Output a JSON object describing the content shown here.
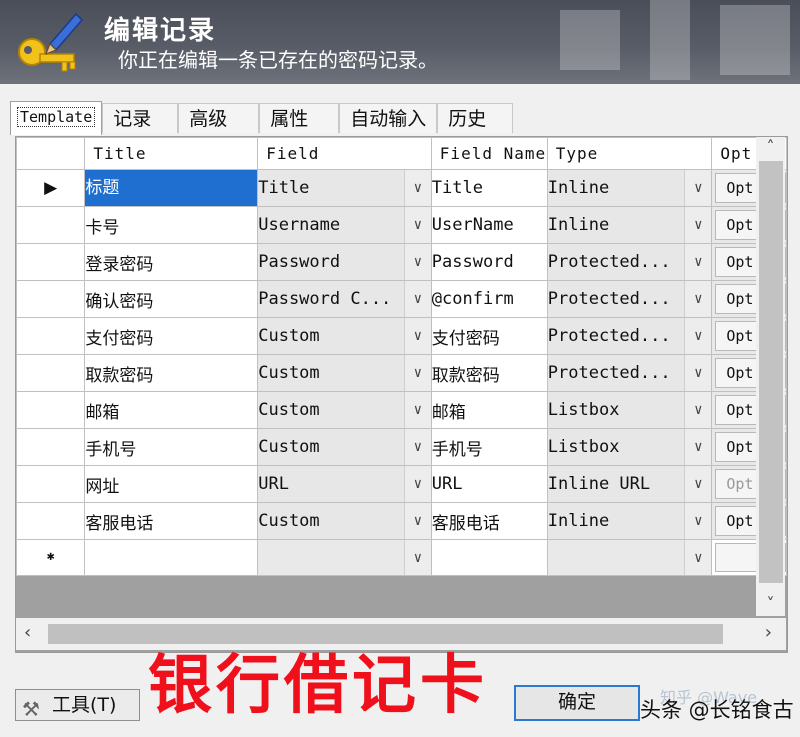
{
  "header": {
    "title": "编辑记录",
    "subtitle": "你正在编辑一条已存在的密码记录。"
  },
  "tabs": [
    {
      "label": "Template",
      "active": true
    },
    {
      "label": "记录"
    },
    {
      "label": "高级"
    },
    {
      "label": "属性"
    },
    {
      "label": "自动输入"
    },
    {
      "label": "历史"
    }
  ],
  "grid": {
    "columns": [
      "Title",
      "Field",
      "Field Name",
      "Type",
      "Opt"
    ],
    "rows": [
      {
        "title": "标题",
        "field": "Title",
        "field_name": "Title",
        "type": "Inline",
        "opt": "Opt"
      },
      {
        "title": "卡号",
        "field": "Username",
        "field_name": "UserName",
        "type": "Inline",
        "opt": "Opt"
      },
      {
        "title": "登录密码",
        "field": "Password",
        "field_name": "Password",
        "type": "Protected...",
        "opt": "Opt"
      },
      {
        "title": "确认密码",
        "field": "Password C...",
        "field_name": "@confirm",
        "type": "Protected...",
        "opt": "Opt"
      },
      {
        "title": "支付密码",
        "field": "Custom",
        "field_name": "支付密码",
        "type": "Protected...",
        "opt": "Opt"
      },
      {
        "title": "取款密码",
        "field": "Custom",
        "field_name": "取款密码",
        "type": "Protected...",
        "opt": "Opt"
      },
      {
        "title": "邮箱",
        "field": "Custom",
        "field_name": "邮箱",
        "type": "Listbox",
        "opt": "Opt"
      },
      {
        "title": "手机号",
        "field": "Custom",
        "field_name": "手机号",
        "type": "Listbox",
        "opt": "Opt"
      },
      {
        "title": "网址",
        "field": "URL",
        "field_name": "URL",
        "type": "Inline URL",
        "opt": "Opt"
      },
      {
        "title": "客服电话",
        "field": "Custom",
        "field_name": "客服电话",
        "type": "Inline",
        "opt": "Opt"
      }
    ]
  },
  "footer": {
    "tools_label": "工具(T)",
    "banner": "银行借记卡",
    "ok_label": "确定",
    "watermark": "头条 @长铭食古",
    "watermark_faint": "知乎 @Wave"
  },
  "colors": {
    "header_bg": "#585c66",
    "selection": "#1f6fd1",
    "banner": "#f0101c",
    "ok_border": "#2a7bd0"
  },
  "icons": {
    "logo": "key-pencil-icon",
    "dropdown": "chevron-down-icon",
    "tools": "tools-icon"
  }
}
